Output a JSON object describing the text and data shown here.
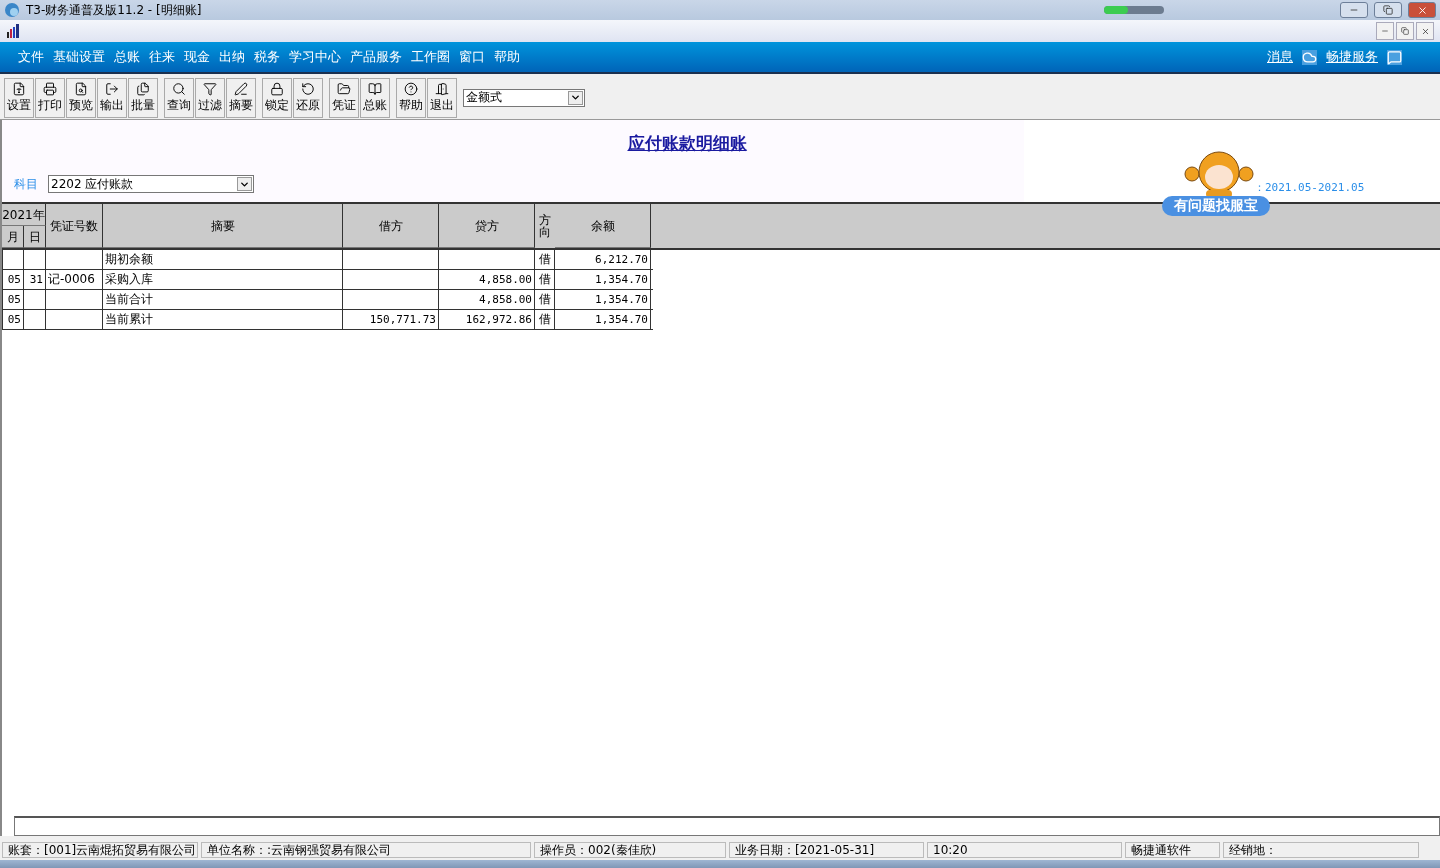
{
  "window": {
    "title": "T3-财务通普及版11.2 - [明细账]"
  },
  "menu": [
    "文件",
    "基础设置",
    "总账",
    "往来",
    "现金",
    "出纳",
    "税务",
    "学习中心",
    "产品服务",
    "工作圈",
    "窗口",
    "帮助"
  ],
  "menu_links": [
    "消息",
    "畅捷服务"
  ],
  "toolbar": [
    [
      "设置",
      "打印",
      "预览",
      "输出",
      "批量"
    ],
    [
      "查询",
      "过滤",
      "摘要"
    ],
    [
      "锁定",
      "还原"
    ],
    [
      "凭证",
      "总账"
    ],
    [
      "帮助",
      "退出"
    ]
  ],
  "format_select": {
    "value": "金额式"
  },
  "report": {
    "title": "应付账款明细账",
    "subject_label": "科目",
    "subject_value": "2202 应付账款",
    "period": "：2021.05-2021.05"
  },
  "help_bubble": "有问题找服宝",
  "table": {
    "year": "2021年",
    "month": "月",
    "day": "日",
    "columns": [
      "凭证号数",
      "摘要",
      "借方",
      "贷方",
      "方向",
      "余额"
    ],
    "rows": [
      {
        "month": "",
        "day": "",
        "voucher": "",
        "summary": "期初余额",
        "debit": "",
        "credit": "",
        "direction": "借",
        "balance": "6,212.70"
      },
      {
        "month": "05",
        "day": "31",
        "voucher": "记-0006",
        "summary": "采购入库",
        "debit": "",
        "credit": "4,858.00",
        "direction": "借",
        "balance": "1,354.70"
      },
      {
        "month": "05",
        "day": "",
        "voucher": "",
        "summary": "当前合计",
        "debit": "",
        "credit": "4,858.00",
        "direction": "借",
        "balance": "1,354.70"
      },
      {
        "month": "05",
        "day": "",
        "voucher": "",
        "summary": "当前累计",
        "debit": "150,771.73",
        "credit": "162,972.86",
        "direction": "借",
        "balance": "1,354.70"
      }
    ]
  },
  "status_bar": [
    "账套：[001]云南焜拓贸易有限公司",
    "单位名称：:云南钢强贸易有限公司",
    "操作员：002(秦佳欣)",
    "业务日期：[2021-05-31]",
    "10:20",
    "畅捷通软件",
    "经销地："
  ]
}
